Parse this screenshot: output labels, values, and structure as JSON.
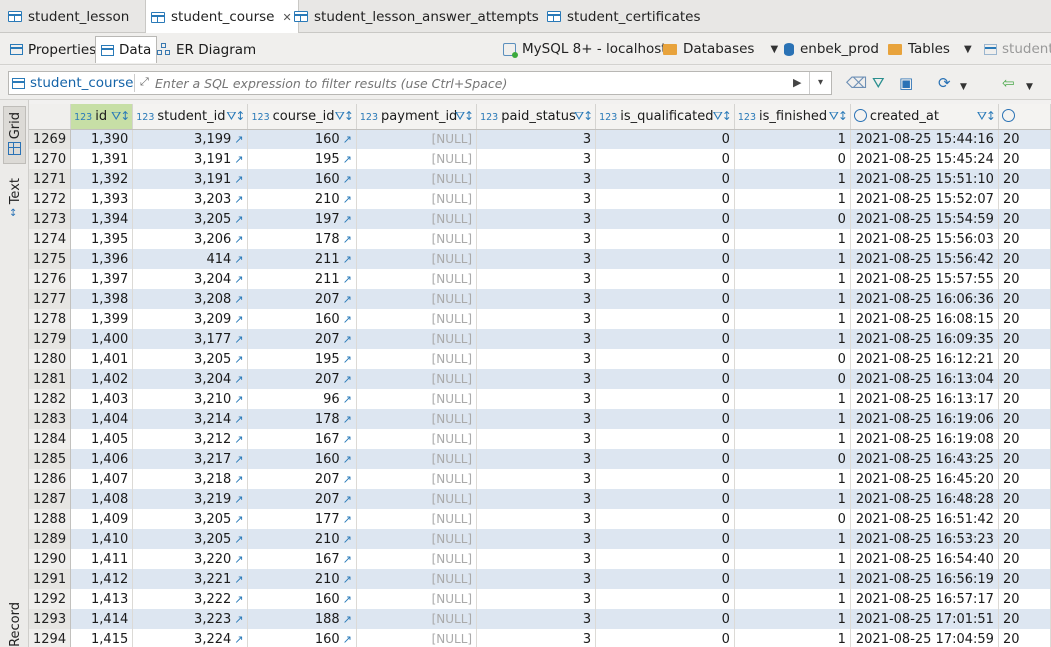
{
  "editor_tabs": [
    {
      "label": "student_lesson",
      "active": false
    },
    {
      "label": "student_course",
      "active": true
    },
    {
      "label": "student_lesson_answer_attempts",
      "active": false
    },
    {
      "label": "student_certificates",
      "active": false
    }
  ],
  "view_tabs": {
    "properties": "Properties",
    "data": "Data",
    "er_diagram": "ER Diagram"
  },
  "breadcrumb": {
    "connection": "MySQL 8+ - localhost",
    "databases": "Databases",
    "schema": "enbek_prod",
    "tables": "Tables",
    "table": "student"
  },
  "filter": {
    "table_label": "student_course",
    "placeholder": "Enter a SQL expression to filter results (use Ctrl+Space)"
  },
  "side_panel": {
    "grid": "Grid",
    "text": "Text",
    "record": "Record"
  },
  "colors": {
    "accent": "#2a7ab8",
    "row_stripe": "#dde6f1",
    "id_header": "#c7dfa6"
  },
  "columns": [
    {
      "name": "id",
      "type": "123"
    },
    {
      "name": "student_id",
      "type": "123"
    },
    {
      "name": "course_id",
      "type": "123"
    },
    {
      "name": "payment_id",
      "type": "123"
    },
    {
      "name": "paid_status",
      "type": "123"
    },
    {
      "name": "is_qualificated",
      "type": "123"
    },
    {
      "name": "is_finished",
      "type": "123"
    },
    {
      "name": "created_at",
      "type": "clock"
    },
    {
      "name": "",
      "type": "clock"
    }
  ],
  "null_text": "[NULL]",
  "rows": [
    {
      "n": "1269",
      "id": "1,390",
      "student_id": "3,199",
      "course_id": "160",
      "paid_status": "3",
      "is_qualificated": "0",
      "is_finished": "1",
      "created_at": "2021-08-25 15:44:16",
      "next": "20"
    },
    {
      "n": "1270",
      "id": "1,391",
      "student_id": "3,191",
      "course_id": "195",
      "paid_status": "3",
      "is_qualificated": "0",
      "is_finished": "0",
      "created_at": "2021-08-25 15:45:24",
      "next": "20"
    },
    {
      "n": "1271",
      "id": "1,392",
      "student_id": "3,191",
      "course_id": "160",
      "paid_status": "3",
      "is_qualificated": "0",
      "is_finished": "1",
      "created_at": "2021-08-25 15:51:10",
      "next": "20"
    },
    {
      "n": "1272",
      "id": "1,393",
      "student_id": "3,203",
      "course_id": "210",
      "paid_status": "3",
      "is_qualificated": "0",
      "is_finished": "1",
      "created_at": "2021-08-25 15:52:07",
      "next": "20"
    },
    {
      "n": "1273",
      "id": "1,394",
      "student_id": "3,205",
      "course_id": "197",
      "paid_status": "3",
      "is_qualificated": "0",
      "is_finished": "0",
      "created_at": "2021-08-25 15:54:59",
      "next": "20"
    },
    {
      "n": "1274",
      "id": "1,395",
      "student_id": "3,206",
      "course_id": "178",
      "paid_status": "3",
      "is_qualificated": "0",
      "is_finished": "1",
      "created_at": "2021-08-25 15:56:03",
      "next": "20"
    },
    {
      "n": "1275",
      "id": "1,396",
      "student_id": "414",
      "course_id": "211",
      "paid_status": "3",
      "is_qualificated": "0",
      "is_finished": "1",
      "created_at": "2021-08-25 15:56:42",
      "next": "20"
    },
    {
      "n": "1276",
      "id": "1,397",
      "student_id": "3,204",
      "course_id": "211",
      "paid_status": "3",
      "is_qualificated": "0",
      "is_finished": "1",
      "created_at": "2021-08-25 15:57:55",
      "next": "20"
    },
    {
      "n": "1277",
      "id": "1,398",
      "student_id": "3,208",
      "course_id": "207",
      "paid_status": "3",
      "is_qualificated": "0",
      "is_finished": "1",
      "created_at": "2021-08-25 16:06:36",
      "next": "20"
    },
    {
      "n": "1278",
      "id": "1,399",
      "student_id": "3,209",
      "course_id": "160",
      "paid_status": "3",
      "is_qualificated": "0",
      "is_finished": "1",
      "created_at": "2021-08-25 16:08:15",
      "next": "20"
    },
    {
      "n": "1279",
      "id": "1,400",
      "student_id": "3,177",
      "course_id": "207",
      "paid_status": "3",
      "is_qualificated": "0",
      "is_finished": "1",
      "created_at": "2021-08-25 16:09:35",
      "next": "20"
    },
    {
      "n": "1280",
      "id": "1,401",
      "student_id": "3,205",
      "course_id": "195",
      "paid_status": "3",
      "is_qualificated": "0",
      "is_finished": "0",
      "created_at": "2021-08-25 16:12:21",
      "next": "20"
    },
    {
      "n": "1281",
      "id": "1,402",
      "student_id": "3,204",
      "course_id": "207",
      "paid_status": "3",
      "is_qualificated": "0",
      "is_finished": "0",
      "created_at": "2021-08-25 16:13:04",
      "next": "20"
    },
    {
      "n": "1282",
      "id": "1,403",
      "student_id": "3,210",
      "course_id": "96",
      "paid_status": "3",
      "is_qualificated": "0",
      "is_finished": "1",
      "created_at": "2021-08-25 16:13:17",
      "next": "20"
    },
    {
      "n": "1283",
      "id": "1,404",
      "student_id": "3,214",
      "course_id": "178",
      "paid_status": "3",
      "is_qualificated": "0",
      "is_finished": "1",
      "created_at": "2021-08-25 16:19:06",
      "next": "20"
    },
    {
      "n": "1284",
      "id": "1,405",
      "student_id": "3,212",
      "course_id": "167",
      "paid_status": "3",
      "is_qualificated": "0",
      "is_finished": "1",
      "created_at": "2021-08-25 16:19:08",
      "next": "20"
    },
    {
      "n": "1285",
      "id": "1,406",
      "student_id": "3,217",
      "course_id": "160",
      "paid_status": "3",
      "is_qualificated": "0",
      "is_finished": "0",
      "created_at": "2021-08-25 16:43:25",
      "next": "20"
    },
    {
      "n": "1286",
      "id": "1,407",
      "student_id": "3,218",
      "course_id": "207",
      "paid_status": "3",
      "is_qualificated": "0",
      "is_finished": "1",
      "created_at": "2021-08-25 16:45:20",
      "next": "20"
    },
    {
      "n": "1287",
      "id": "1,408",
      "student_id": "3,219",
      "course_id": "207",
      "paid_status": "3",
      "is_qualificated": "0",
      "is_finished": "1",
      "created_at": "2021-08-25 16:48:28",
      "next": "20"
    },
    {
      "n": "1288",
      "id": "1,409",
      "student_id": "3,205",
      "course_id": "177",
      "paid_status": "3",
      "is_qualificated": "0",
      "is_finished": "0",
      "created_at": "2021-08-25 16:51:42",
      "next": "20"
    },
    {
      "n": "1289",
      "id": "1,410",
      "student_id": "3,205",
      "course_id": "210",
      "paid_status": "3",
      "is_qualificated": "0",
      "is_finished": "1",
      "created_at": "2021-08-25 16:53:23",
      "next": "20"
    },
    {
      "n": "1290",
      "id": "1,411",
      "student_id": "3,220",
      "course_id": "167",
      "paid_status": "3",
      "is_qualificated": "0",
      "is_finished": "1",
      "created_at": "2021-08-25 16:54:40",
      "next": "20"
    },
    {
      "n": "1291",
      "id": "1,412",
      "student_id": "3,221",
      "course_id": "210",
      "paid_status": "3",
      "is_qualificated": "0",
      "is_finished": "1",
      "created_at": "2021-08-25 16:56:19",
      "next": "20"
    },
    {
      "n": "1292",
      "id": "1,413",
      "student_id": "3,222",
      "course_id": "160",
      "paid_status": "3",
      "is_qualificated": "0",
      "is_finished": "1",
      "created_at": "2021-08-25 16:57:17",
      "next": "20"
    },
    {
      "n": "1293",
      "id": "1,414",
      "student_id": "3,223",
      "course_id": "188",
      "paid_status": "3",
      "is_qualificated": "0",
      "is_finished": "1",
      "created_at": "2021-08-25 17:01:51",
      "next": "20"
    },
    {
      "n": "1294",
      "id": "1,415",
      "student_id": "3,224",
      "course_id": "160",
      "paid_status": "3",
      "is_qualificated": "0",
      "is_finished": "1",
      "created_at": "2021-08-25 17:04:59",
      "next": "20"
    }
  ]
}
